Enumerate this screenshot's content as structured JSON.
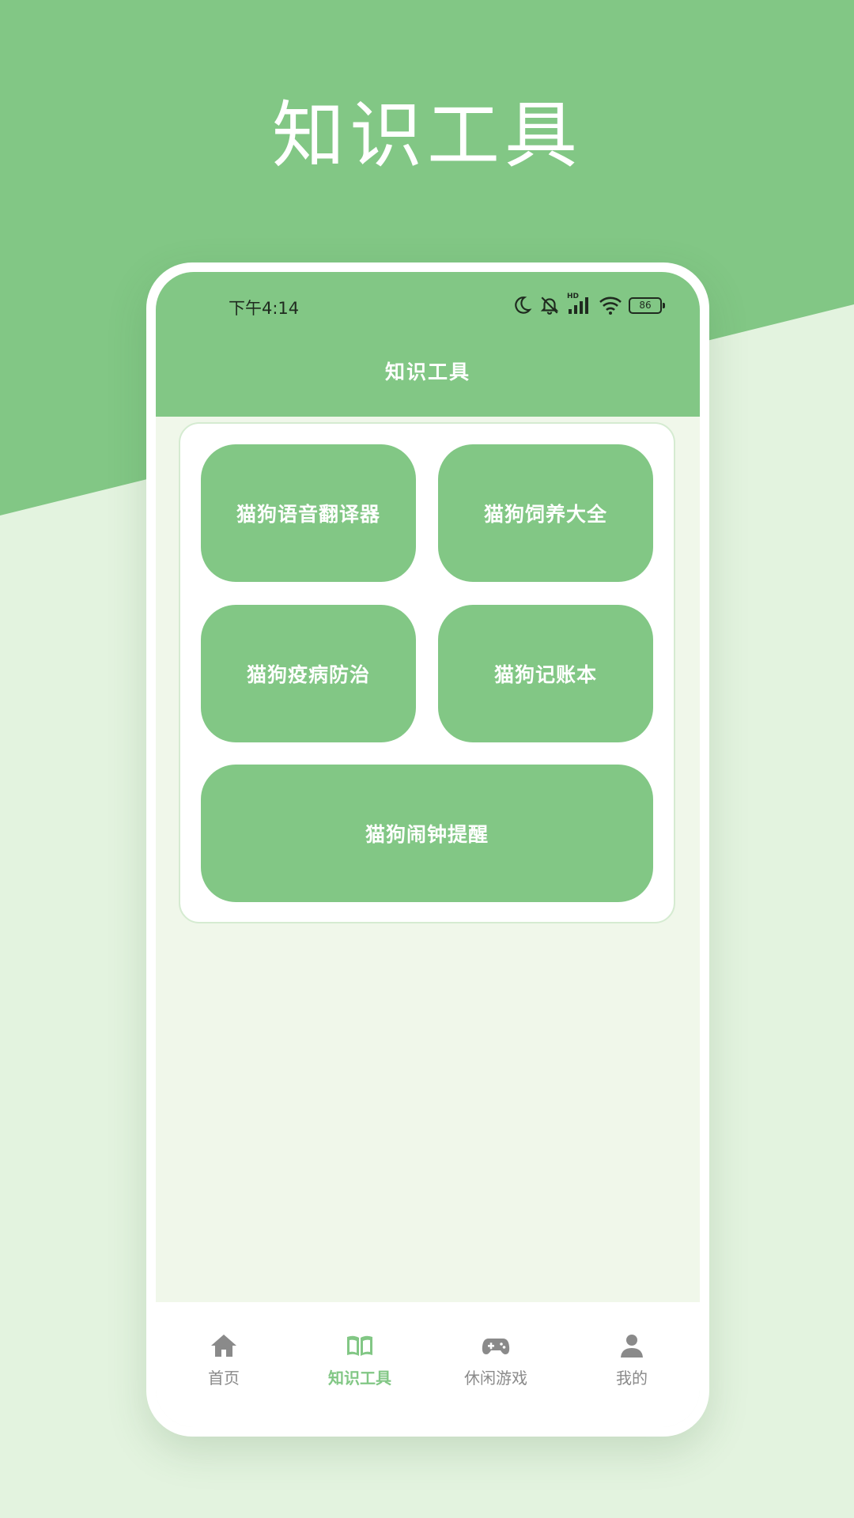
{
  "promo": {
    "title": "知识工具"
  },
  "status_bar": {
    "time": "下午4:14",
    "battery": "86",
    "hd_label": "HD"
  },
  "header": {
    "title": "知识工具"
  },
  "tools": [
    {
      "label": "猫狗语音翻译器"
    },
    {
      "label": "猫狗饲养大全"
    },
    {
      "label": "猫狗疫病防治"
    },
    {
      "label": "猫狗记账本"
    },
    {
      "label": "猫狗闹钟提醒"
    }
  ],
  "tabs": [
    {
      "label": "首页",
      "icon": "home-icon",
      "active": false
    },
    {
      "label": "知识工具",
      "icon": "book-icon",
      "active": true
    },
    {
      "label": "休闲游戏",
      "icon": "gamepad-icon",
      "active": false
    },
    {
      "label": "我的",
      "icon": "person-icon",
      "active": false
    }
  ],
  "colors": {
    "brand_green": "#82C785",
    "background_light": "#E3F3DF",
    "screen_bg": "#F0F7EA",
    "tab_inactive": "#8A8A8A"
  }
}
